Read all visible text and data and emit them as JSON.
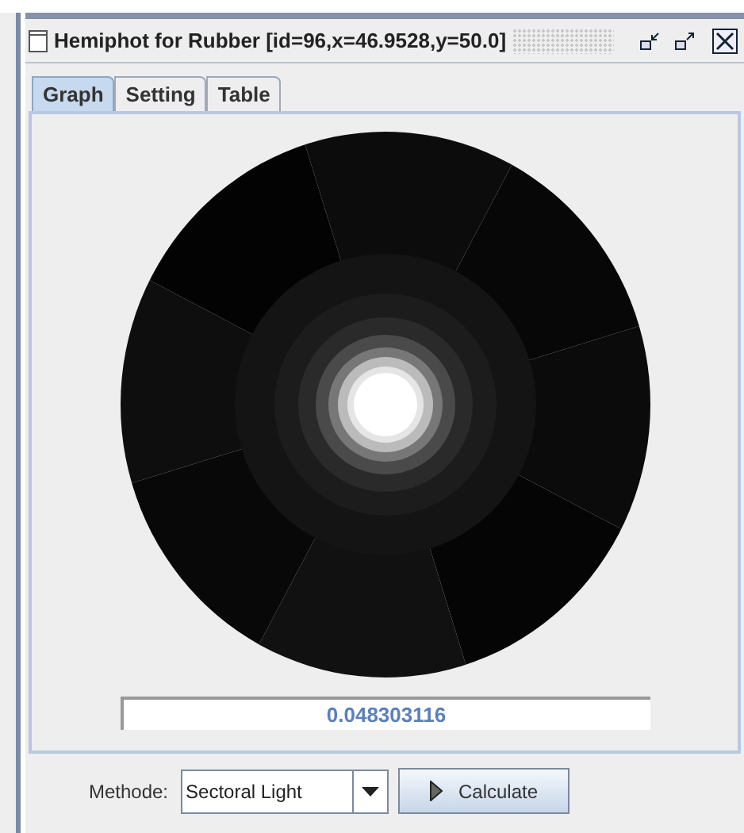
{
  "window": {
    "title": "Hemiphot for Rubber [id=96,x=46.9528,y=50.0]"
  },
  "tabs": [
    {
      "label": "Graph",
      "selected": true
    },
    {
      "label": "Setting",
      "selected": false
    },
    {
      "label": "Table",
      "selected": false
    }
  ],
  "result": "0.048303116",
  "method": {
    "label": "Methode:",
    "value": "Sectoral Light"
  },
  "calculate_button": "Calculate"
}
